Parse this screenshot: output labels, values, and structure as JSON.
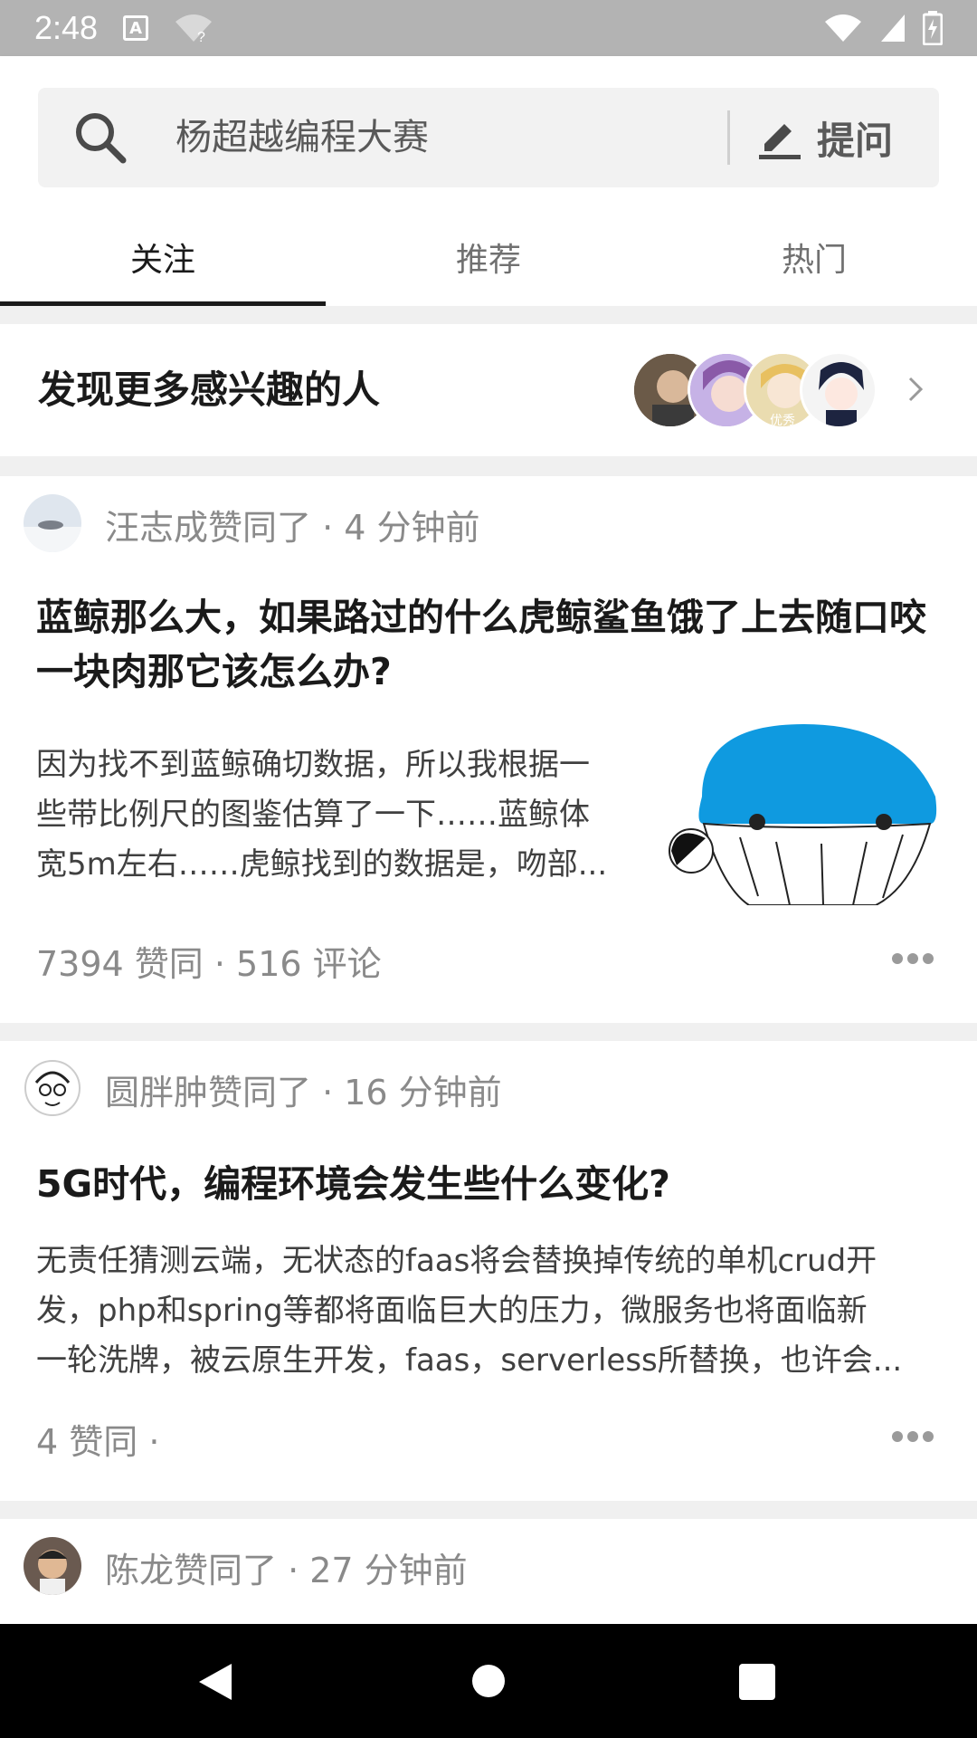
{
  "status_bar": {
    "time": "2:48"
  },
  "search": {
    "placeholder": "杨超越编程大赛",
    "ask_label": "提问"
  },
  "tabs": [
    {
      "label": "关注",
      "active": true
    },
    {
      "label": "推荐",
      "active": false
    },
    {
      "label": "热门",
      "active": false
    }
  ],
  "discover": {
    "title": "发现更多感兴趣的人",
    "badge_text": "优秀"
  },
  "feed": [
    {
      "meta": "汪志成赞同了 · 4 分钟前",
      "title": "蓝鲸那么大，如果路过的什么虎鲸鲨鱼饿了上去随口咬一块肉那它该怎么办?",
      "excerpt_lines": [
        "因为找不到蓝鲸确切数据，所以我根据一",
        "些带比例尺的图鉴估算了一下……蓝鲸体",
        "宽5m左右……虎鲸找到的数据是，吻部..."
      ],
      "stats": "7394 赞同 · 516 评论"
    },
    {
      "meta": "圆胖肿赞同了 · 16 分钟前",
      "title": "5G时代，编程环境会发生些什么变化?",
      "excerpt_lines": [
        "无责任猜测云端，无状态的faas将会替换掉传统的单机crud开",
        "发，php和spring等都将面临巨大的压力，微服务也将面临新",
        "一轮洗牌，被云原生开发，faas，serverless所替换，也许会..."
      ],
      "stats": "4 赞同 ·"
    },
    {
      "meta": "陈龙赞同了 · 27 分钟前"
    }
  ],
  "colors": {
    "status_bar": "#b3b3b3",
    "whale": "#0f9ae0",
    "divider": "#f0f0f0"
  }
}
